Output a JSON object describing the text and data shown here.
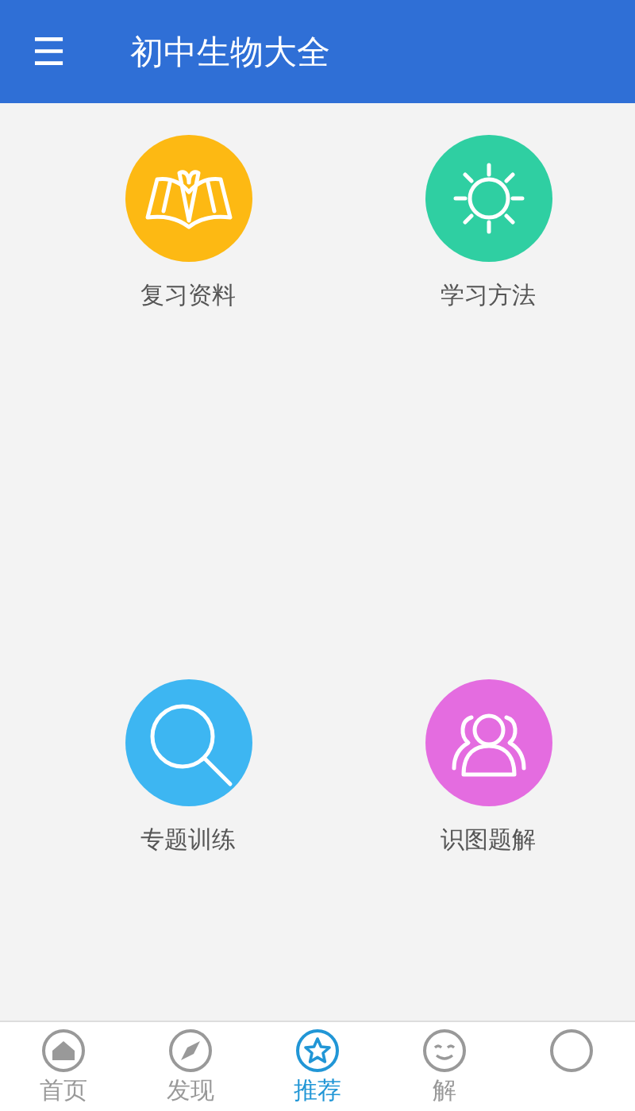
{
  "app_bar": {
    "menu_icon": "☰",
    "title": "初中生物大全"
  },
  "tiles": [
    {
      "label": "复习资料",
      "kind": "book",
      "color": "#fdb913"
    },
    {
      "label": "学习方法",
      "kind": "sun",
      "color": "#2fcfa2"
    },
    {
      "label": "专题训练",
      "kind": "search",
      "color": "#3db6f2"
    },
    {
      "label": "识图题解",
      "kind": "people",
      "color": "#e46ce0"
    }
  ],
  "bottom_nav": [
    {
      "label": "首页",
      "kind": "home",
      "selected": false
    },
    {
      "label": "发现",
      "kind": "compass",
      "selected": false
    },
    {
      "label": "推荐",
      "kind": "star",
      "selected": true
    },
    {
      "label": "解",
      "kind": "smiley",
      "selected": false
    },
    {
      "kind": "circle",
      "selected": false
    }
  ]
}
